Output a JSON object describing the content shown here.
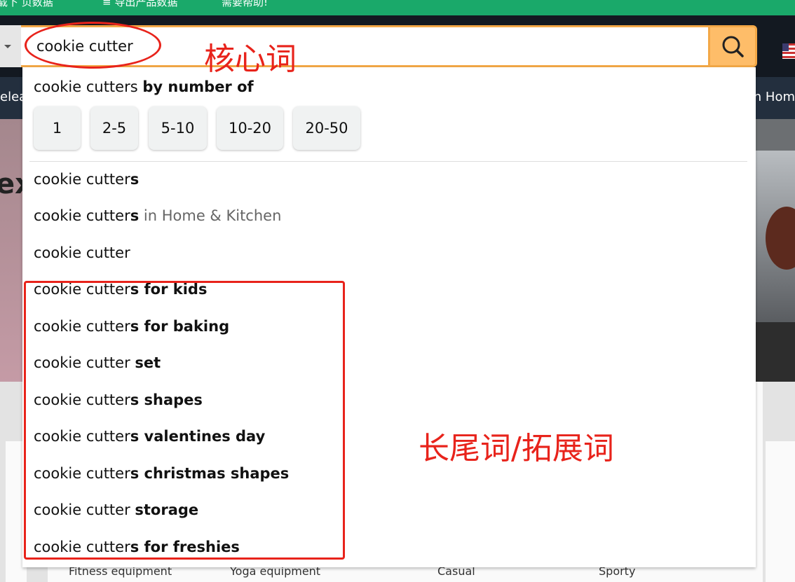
{
  "toolbar": {
    "item1": "载下 页数据",
    "item2": "≡ 导出产品数据",
    "item3": "需要帮助!"
  },
  "nav": {
    "left_fragment": "elea",
    "right_fragment": "n Hom"
  },
  "hero": {
    "fragment": "ex"
  },
  "search": {
    "query": "cookie cutter",
    "department_icon": "chevron-down-icon",
    "button_icon": "search-icon"
  },
  "dropdown": {
    "header": {
      "prefix": "cookie cutters",
      "bold": "by number of"
    },
    "chips": [
      "1",
      "2-5",
      "5-10",
      "10-20",
      "20-50"
    ],
    "suggestions": [
      {
        "base": "cookie cutter",
        "bold": "s",
        "rest": "",
        "category": ""
      },
      {
        "base": "cookie cutter",
        "bold": "s",
        "rest": "",
        "category": "in Home & Kitchen"
      },
      {
        "base": "cookie cutter",
        "bold": "",
        "rest": "",
        "category": ""
      },
      {
        "base": "cookie cutter",
        "bold": "s for kids",
        "rest": "",
        "category": ""
      },
      {
        "base": "cookie cutter",
        "bold": "s for baking",
        "rest": "",
        "category": ""
      },
      {
        "base": "cookie cutter ",
        "bold": "set",
        "rest": "",
        "category": ""
      },
      {
        "base": "cookie cutter",
        "bold": "s shapes",
        "rest": "",
        "category": ""
      },
      {
        "base": "cookie cutter",
        "bold": "s valentines day",
        "rest": "",
        "category": ""
      },
      {
        "base": "cookie cutter",
        "bold": "s christmas shapes",
        "rest": "",
        "category": ""
      },
      {
        "base": "cookie cutter ",
        "bold": "storage",
        "rest": "",
        "category": ""
      },
      {
        "base": "cookie cutter",
        "bold": "s for freshies",
        "rest": "",
        "category": ""
      }
    ]
  },
  "background_labels": [
    "Fitness equipment",
    "Yoga equipment",
    "Casual",
    "Sporty"
  ],
  "annotations": {
    "core_word": "核心词",
    "long_tail": "长尾词/拓展词",
    "color": "#e8231b"
  },
  "colors": {
    "header": "#131921",
    "toolbar": "#1aa96a",
    "search_accent": "#f3a847",
    "search_button": "#febd69"
  }
}
